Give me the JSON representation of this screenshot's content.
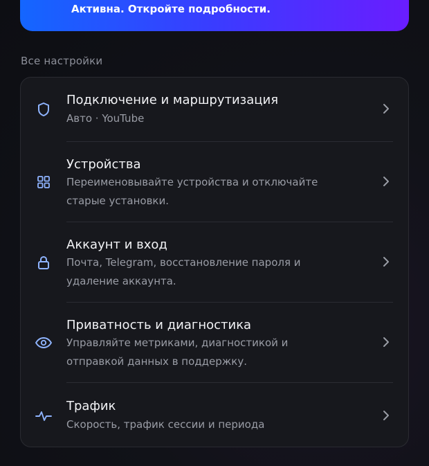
{
  "banner": {
    "text": "Активна. Откройте подробности."
  },
  "section": {
    "title": "Все настройки"
  },
  "settings": {
    "items": [
      {
        "icon": "shield-icon",
        "title": "Подключение и маршрутизация",
        "subtitle": "Авто · YouTube"
      },
      {
        "icon": "grid-icon",
        "title": "Устройства",
        "subtitle_line1": "Переименовывайте устройства и отключайте",
        "subtitle_line2": "старые установки."
      },
      {
        "icon": "lock-icon",
        "title": "Аккаунт и вход",
        "subtitle_line1": "Почта, Telegram, восстановление пароля и",
        "subtitle_line2": "удаление аккаунта."
      },
      {
        "icon": "eye-icon",
        "title": "Приватность и диагностика",
        "subtitle_line1": "Управляйте метриками, диагностикой и",
        "subtitle_line2": "отправкой данных в поддержку."
      },
      {
        "icon": "pulse-icon",
        "title": "Трафик",
        "subtitle": "Скорость, трафик сессии и периода"
      }
    ]
  },
  "colors": {
    "accent_icon": "#8fb4ff",
    "banner_start": "#1466ff",
    "banner_end": "#6a1dff"
  }
}
